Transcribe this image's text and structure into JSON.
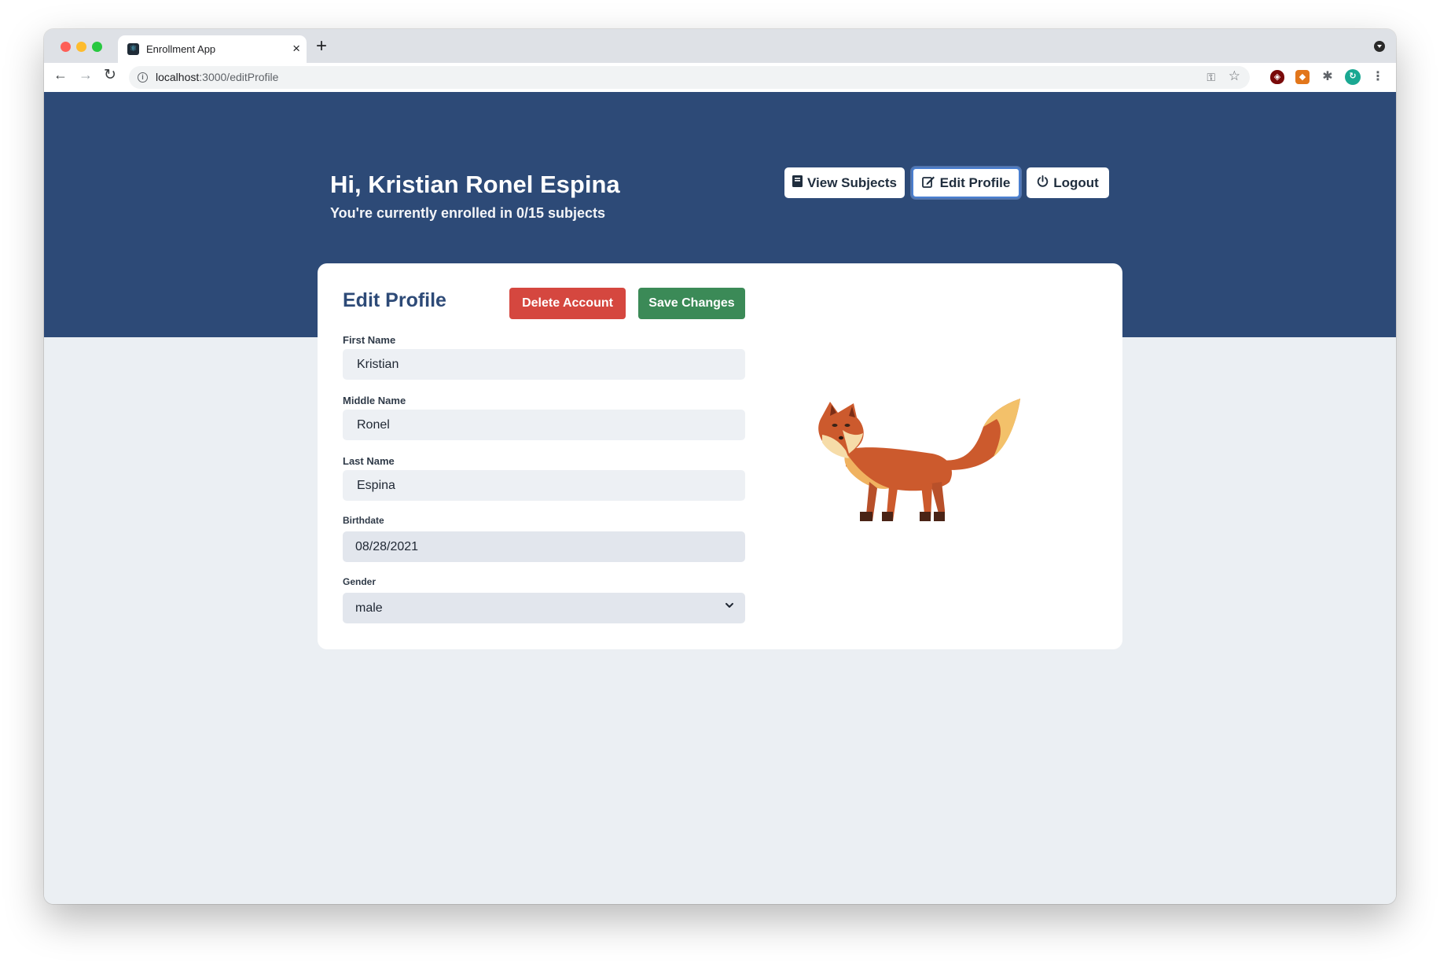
{
  "browser": {
    "tab_title": "Enrollment App",
    "favicon": "react-icon",
    "url_host": "localhost",
    "url_path": ":3000/editProfile"
  },
  "header": {
    "greeting": "Hi, Kristian Ronel Espina",
    "enrollment_text": "You're currently enrolled in 0/15 subjects",
    "buttons": {
      "view_subjects": "View Subjects",
      "edit_profile": "Edit Profile",
      "logout": "Logout"
    }
  },
  "form": {
    "title": "Edit Profile",
    "delete_label": "Delete Account",
    "save_label": "Save Changes",
    "fields": {
      "first_name": {
        "label": "First Name",
        "value": "Kristian"
      },
      "middle_name": {
        "label": "Middle Name",
        "value": "Ronel"
      },
      "last_name": {
        "label": "Last Name",
        "value": "Espina"
      },
      "birthdate": {
        "label": "Birthdate",
        "value": "08/28/2021"
      },
      "gender": {
        "label": "Gender",
        "value": "male"
      }
    }
  },
  "colors": {
    "hero": "#2d4a77",
    "delete": "#d5473f",
    "save": "#3b8a57",
    "page_bg": "#ebeff3"
  }
}
